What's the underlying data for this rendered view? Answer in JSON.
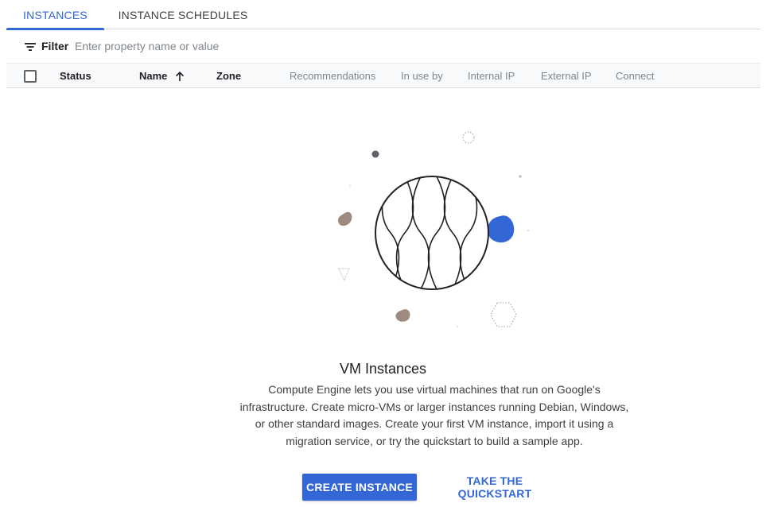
{
  "tabs": [
    {
      "label": "INSTANCES",
      "active": true
    },
    {
      "label": "INSTANCE SCHEDULES",
      "active": false
    }
  ],
  "filter": {
    "label": "Filter",
    "placeholder": "Enter property name or value"
  },
  "table": {
    "columns": [
      "Status",
      "Name",
      "Zone",
      "Recommendations",
      "In use by",
      "Internal IP",
      "External IP",
      "Connect"
    ],
    "sort_column": "Name",
    "sort_direction": "ascending"
  },
  "empty_state": {
    "title": "VM Instances",
    "description": "Compute Engine lets you use virtual machines that run on Google's infrastructure. Create micro-VMs or larger instances running Debian, Windows, or other standard images. Create your first VM instance, import it using a migration service, or try the quickstart to build a sample app."
  },
  "actions": {
    "primary_label": "CREATE INSTANCE",
    "secondary_label": "TAKE THE QUICKSTART"
  },
  "icons": {
    "filter": "filter-list-icon",
    "sort": "arrow-upward-icon",
    "illustration": "vm-globe-illustration"
  },
  "colors": {
    "accent": "#3367d6",
    "decor_brown": "#9e8a80",
    "decor_dark": "#5f6368"
  }
}
